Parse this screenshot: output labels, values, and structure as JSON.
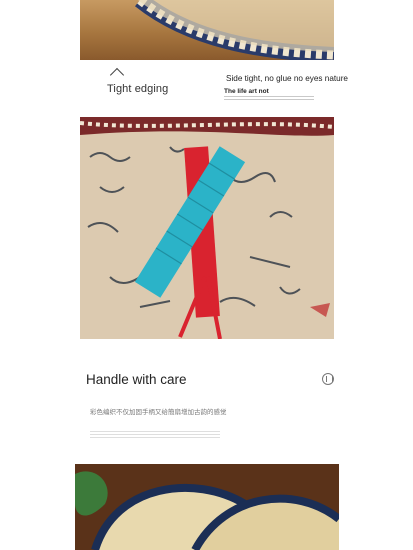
{
  "top_section": {
    "label_left": "Tight edging",
    "caption_right": "Side tight, no glue no eyes nature",
    "caption_right_2": "The life art not"
  },
  "middle_section": {
    "title": "Handle with care",
    "description_cn": "彩色编织不仅加固手柄又给簡扇增加古韵的感觉"
  },
  "colors": {
    "handle_blue": "#2bb3c8",
    "handle_red": "#d9232f",
    "cloth": "#d9c6a8",
    "wood": "#7a4a26"
  }
}
